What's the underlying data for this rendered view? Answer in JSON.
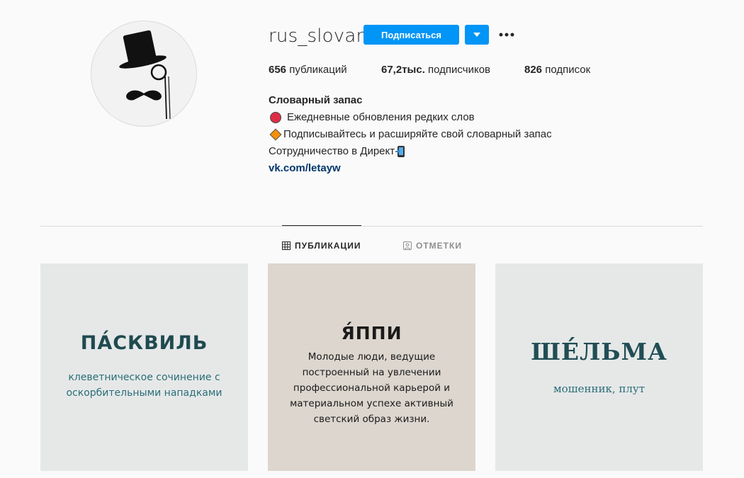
{
  "profile": {
    "username": "rus_slovar",
    "follow_label": "Подписаться",
    "stats": {
      "posts_count": "656",
      "posts_label": "публикаций",
      "followers_count": "67,2тыс.",
      "followers_label": "подписчиков",
      "following_count": "826",
      "following_label": "подписок"
    },
    "bio": {
      "name": "Словарный запас",
      "line1": "Ежедневные обновления редких слов",
      "line2": "Подписывайтесь и расширяйте свой словарный запас",
      "line3": "Сотрудничество в Директ",
      "link": "vk.com/letayw"
    }
  },
  "tabs": [
    {
      "label": "ПУБЛИКАЦИИ",
      "active": true,
      "icon": "grid-icon"
    },
    {
      "label": "ОТМЕТКИ",
      "active": false,
      "icon": "tagged-person-icon"
    }
  ],
  "posts": [
    {
      "word": "ПА́СКВИЛЬ",
      "definition": "клеветническое сочинение с оскорбительными нападками",
      "background": "#e6e8e8"
    },
    {
      "word": "Я́ППИ",
      "definition": "Молодые люди, ведущие построенный на увлечении профессиональной карьерой и материальном успехе активный светский образ жизни.",
      "background": "#dcd6ce"
    },
    {
      "word": "ШЕ́ЛЬМА",
      "definition": "мошенник, плут",
      "background": "#e6e8e8"
    }
  ],
  "colors": {
    "accent": "#0095f6",
    "link": "#00376b",
    "divider": "#dbdbdb",
    "muted": "#8e8e8e"
  }
}
